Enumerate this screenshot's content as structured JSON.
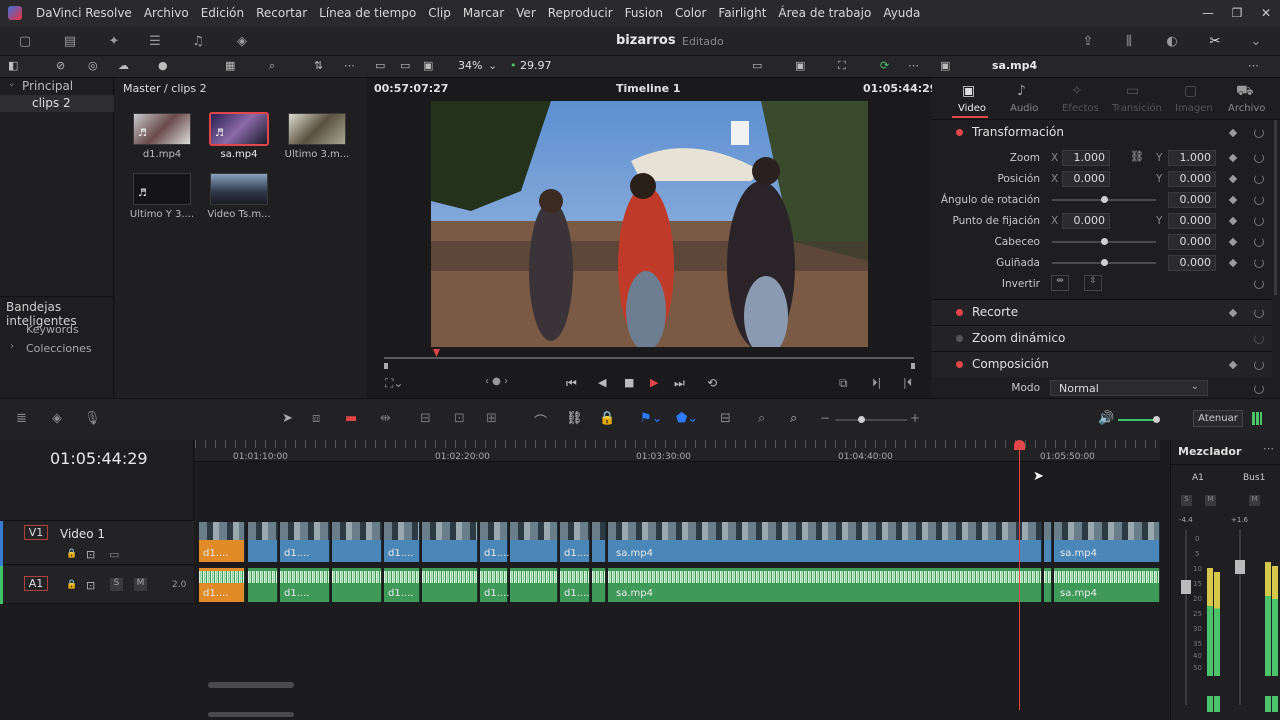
{
  "menu": {
    "items": [
      "DaVinci Resolve",
      "Archivo",
      "Edición",
      "Recortar",
      "Línea de tiempo",
      "Clip",
      "Marcar",
      "Ver",
      "Reproducir",
      "Fusion",
      "Color",
      "Fairlight",
      "Área de trabajo",
      "Ayuda"
    ]
  },
  "toolbar": {
    "project_name": "bizarros",
    "project_status": "Editado"
  },
  "subbar": {
    "zoom": "34%",
    "fps": "29.97",
    "source_tc": "00:57:07:27",
    "timeline_name": "Timeline 1",
    "record_tc": "01:05:44:29",
    "clip_name": "sa.mp4"
  },
  "media_pool": {
    "tree": {
      "root": "Principal",
      "child": "clips 2"
    },
    "smart_bins": {
      "title": "Bandejas inteligentes",
      "items": [
        "Keywords",
        "Colecciones"
      ]
    },
    "breadcrumb": "Master / clips 2",
    "clips": [
      {
        "name": "d1.mp4",
        "selected": false
      },
      {
        "name": "sa.mp4",
        "selected": true
      },
      {
        "name": "Ultimo 3.m...",
        "selected": false
      },
      {
        "name": "Ultimo Y 3....",
        "selected": false
      },
      {
        "name": "Video Ts.m...",
        "selected": false
      }
    ]
  },
  "inspector": {
    "tabs": [
      {
        "label": "Video",
        "active": true
      },
      {
        "label": "Audio",
        "active": false
      },
      {
        "label": "Efectos",
        "active": false
      },
      {
        "label": "Transición",
        "active": false
      },
      {
        "label": "Imagen",
        "active": false
      },
      {
        "label": "Archivo",
        "active": false
      }
    ],
    "transform": {
      "title": "Transformación",
      "zoom_label": "Zoom",
      "zoom_x": "1.000",
      "zoom_y": "1.000",
      "pos_label": "Posición",
      "pos_x": "0.000",
      "pos_y": "0.000",
      "rot_label": "Ángulo de rotación",
      "rot": "0.000",
      "anchor_label": "Punto de fijación",
      "anchor_x": "0.000",
      "anchor_y": "0.000",
      "pitch_label": "Cabeceo",
      "pitch": "0.000",
      "yaw_label": "Guiñada",
      "yaw": "0.000",
      "flip_label": "Invertir",
      "x_lbl": "X",
      "y_lbl": "Y"
    },
    "sections": [
      "Recorte",
      "Zoom dinámico",
      "Composición"
    ],
    "mode_label": "Modo",
    "mode_value": "Normal"
  },
  "timeline": {
    "timecode": "01:05:44:29",
    "ruler": [
      "01:01:10:00",
      "01:02:20:00",
      "01:03:30:00",
      "01:04:40:00",
      "01:05:50:00"
    ],
    "v1": {
      "id": "V1",
      "name": "Video 1"
    },
    "a1": {
      "id": "A1",
      "level": "2.0",
      "s": "S",
      "m": "M"
    },
    "clip_labels": {
      "d1": "d1....",
      "sa": "sa.mp4"
    }
  },
  "mixer": {
    "title": "Mezclador",
    "ch1": "A1",
    "ch2": "Bus1",
    "s": "S",
    "m": "M",
    "lvl1": "-4.4",
    "lvl2": "+1.6",
    "atenuar": "Atenuar",
    "scale": [
      "0",
      "5",
      "10",
      "15",
      "20",
      "25",
      "30",
      "35",
      "40",
      "50"
    ]
  },
  "colors": {
    "accent_red": "#e0464a",
    "video_clip": "#4a86b8",
    "audio_clip": "#3f9a5a",
    "orange": "#e08a28"
  }
}
